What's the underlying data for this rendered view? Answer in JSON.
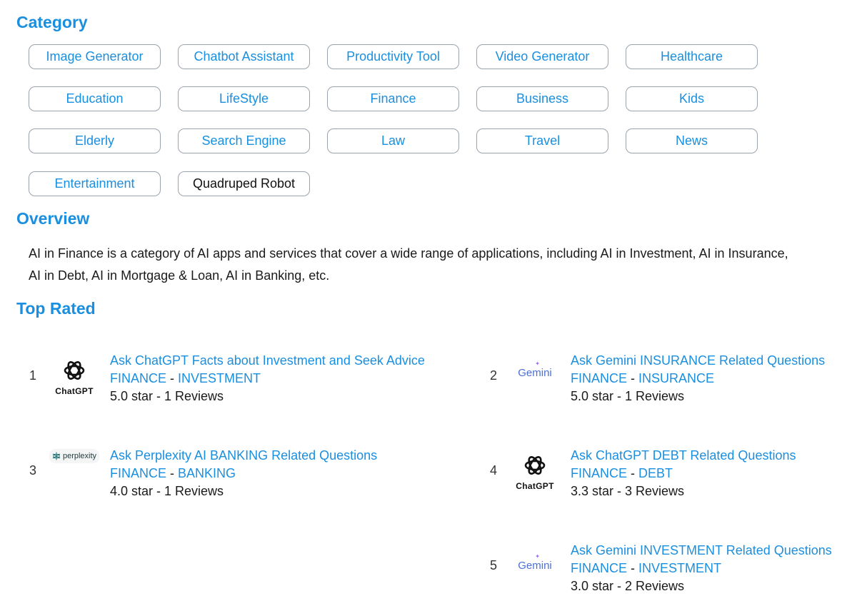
{
  "sections": {
    "category_title": "Category",
    "overview_title": "Overview",
    "top_rated_title": "Top Rated"
  },
  "categories": [
    "Image Generator",
    "Chatbot Assistant",
    "Productivity Tool",
    "Video Generator",
    "Healthcare",
    "Education",
    "LifeStyle",
    "Finance",
    "Business",
    "Kids",
    "Elderly",
    "Search Engine",
    "Law",
    "Travel",
    "News",
    "Entertainment",
    "Quadruped Robot"
  ],
  "overview": {
    "text": "AI in Finance is a category of AI apps and services that cover a wide range of applications, including AI in Investment, AI in Insurance, AI in Debt, AI in Mortgage & Loan, AI in Banking, etc."
  },
  "top_rated": [
    {
      "rank": "1",
      "logo": "chatgpt-logo",
      "logo_text": "ChatGPT",
      "title": "Ask ChatGPT Facts about Investment and Seek Advice",
      "tag1": "FINANCE",
      "separator": " - ",
      "tag2": "INVESTMENT",
      "rating": "5.0 star - 1 Reviews"
    },
    {
      "rank": "2",
      "logo": "gemini-logo",
      "logo_text": "Gemini",
      "title": "Ask Gemini INSURANCE Related Questions",
      "tag1": "FINANCE",
      "separator": " - ",
      "tag2": "INSURANCE",
      "rating": "5.0 star - 1 Reviews"
    },
    {
      "rank": "3",
      "logo": "perplexity-logo",
      "logo_text": "perplexity",
      "title": "Ask Perplexity AI BANKING Related Questions",
      "tag1": "FINANCE",
      "separator": " - ",
      "tag2": "BANKING",
      "rating": "4.0 star - 1 Reviews"
    },
    {
      "rank": "4",
      "logo": "chatgpt-logo",
      "logo_text": "ChatGPT",
      "title": "Ask ChatGPT DEBT Related Questions",
      "tag1": "FINANCE",
      "separator": " - ",
      "tag2": "DEBT",
      "rating": "3.3 star - 3 Reviews"
    },
    {
      "rank": "5",
      "logo": "gemini-logo",
      "logo_text": "Gemini",
      "title": "Ask Gemini INVESTMENT Related Questions",
      "tag1": "FINANCE",
      "separator": " - ",
      "tag2": "INVESTMENT",
      "rating": "3.0 star - 2 Reviews"
    }
  ],
  "colors": {
    "accent": "#1a8fe0",
    "border": "#9aa3ad",
    "text": "#1a1a1a"
  }
}
